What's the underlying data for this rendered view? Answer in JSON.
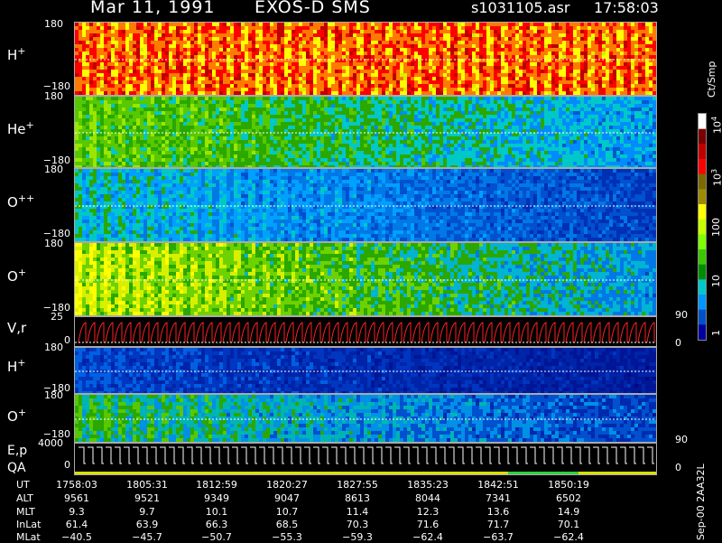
{
  "header": {
    "date": "Mar 11, 1991",
    "mission": "EXOS-D SMS",
    "file": "s1031105.asr",
    "time": "17:58:03"
  },
  "panels": [
    {
      "label": "H",
      "sup": "+",
      "ymax": "180",
      "ymin": "−180"
    },
    {
      "label": "He",
      "sup": "+",
      "ymax": "180",
      "ymin": "−180"
    },
    {
      "label": "O",
      "sup": "++",
      "ymax": "180",
      "ymin": "−180"
    },
    {
      "label": "O",
      "sup": "+",
      "ymax": "180",
      "ymin": "−180"
    },
    {
      "label": "V,r",
      "sup": "",
      "ymax": "25",
      "ymin": "0",
      "right_top": "90",
      "right_bottom": "0"
    },
    {
      "label": "H",
      "sup": "+",
      "ymax": "180",
      "ymin": "−180"
    },
    {
      "label": "O",
      "sup": "+",
      "ymax": "180",
      "ymin": "−180",
      "right_bottom": "90"
    },
    {
      "label": "E,p",
      "label2": "QA",
      "ymax": "4000",
      "ymin": "0",
      "right_bottom": "0"
    }
  ],
  "colorbar": {
    "unit": "Ct/Smp",
    "ticks": [
      "10",
      "10",
      "100",
      "10",
      "1"
    ],
    "tick_sups": [
      "4",
      "3",
      "",
      "",
      ""
    ],
    "colors": [
      "#ffffff",
      "#7a0000",
      "#c00000",
      "#ff0000",
      "#7a6a00",
      "#a08a00",
      "#ffff00",
      "#c8ff00",
      "#7fff00",
      "#3cc800",
      "#008c00",
      "#00c8c8",
      "#0096ff",
      "#0050c8",
      "#0000a0"
    ]
  },
  "ephemeris": {
    "labels": [
      "UT",
      "ALT",
      "MLT",
      "InLat",
      "MLat"
    ],
    "columns": [
      [
        "1758:03",
        "9561",
        "9.3",
        "61.4",
        "−40.5"
      ],
      [
        "1805:31",
        "9521",
        "9.7",
        "63.9",
        "−45.7"
      ],
      [
        "1812:59",
        "9349",
        "10.1",
        "66.3",
        "−50.7"
      ],
      [
        "1820:27",
        "9047",
        "10.7",
        "68.5",
        "−55.3"
      ],
      [
        "1827:55",
        "8613",
        "11.4",
        "70.3",
        "−59.3"
      ],
      [
        "1835:23",
        "8044",
        "12.3",
        "71.6",
        "−62.4"
      ],
      [
        "1842:51",
        "7341",
        "13.6",
        "71.7",
        "−63.7"
      ],
      [
        "1850:19",
        "6502",
        "14.9",
        "70.1",
        "−62.4"
      ]
    ]
  },
  "footer": "Sep-00 2AA32L"
}
